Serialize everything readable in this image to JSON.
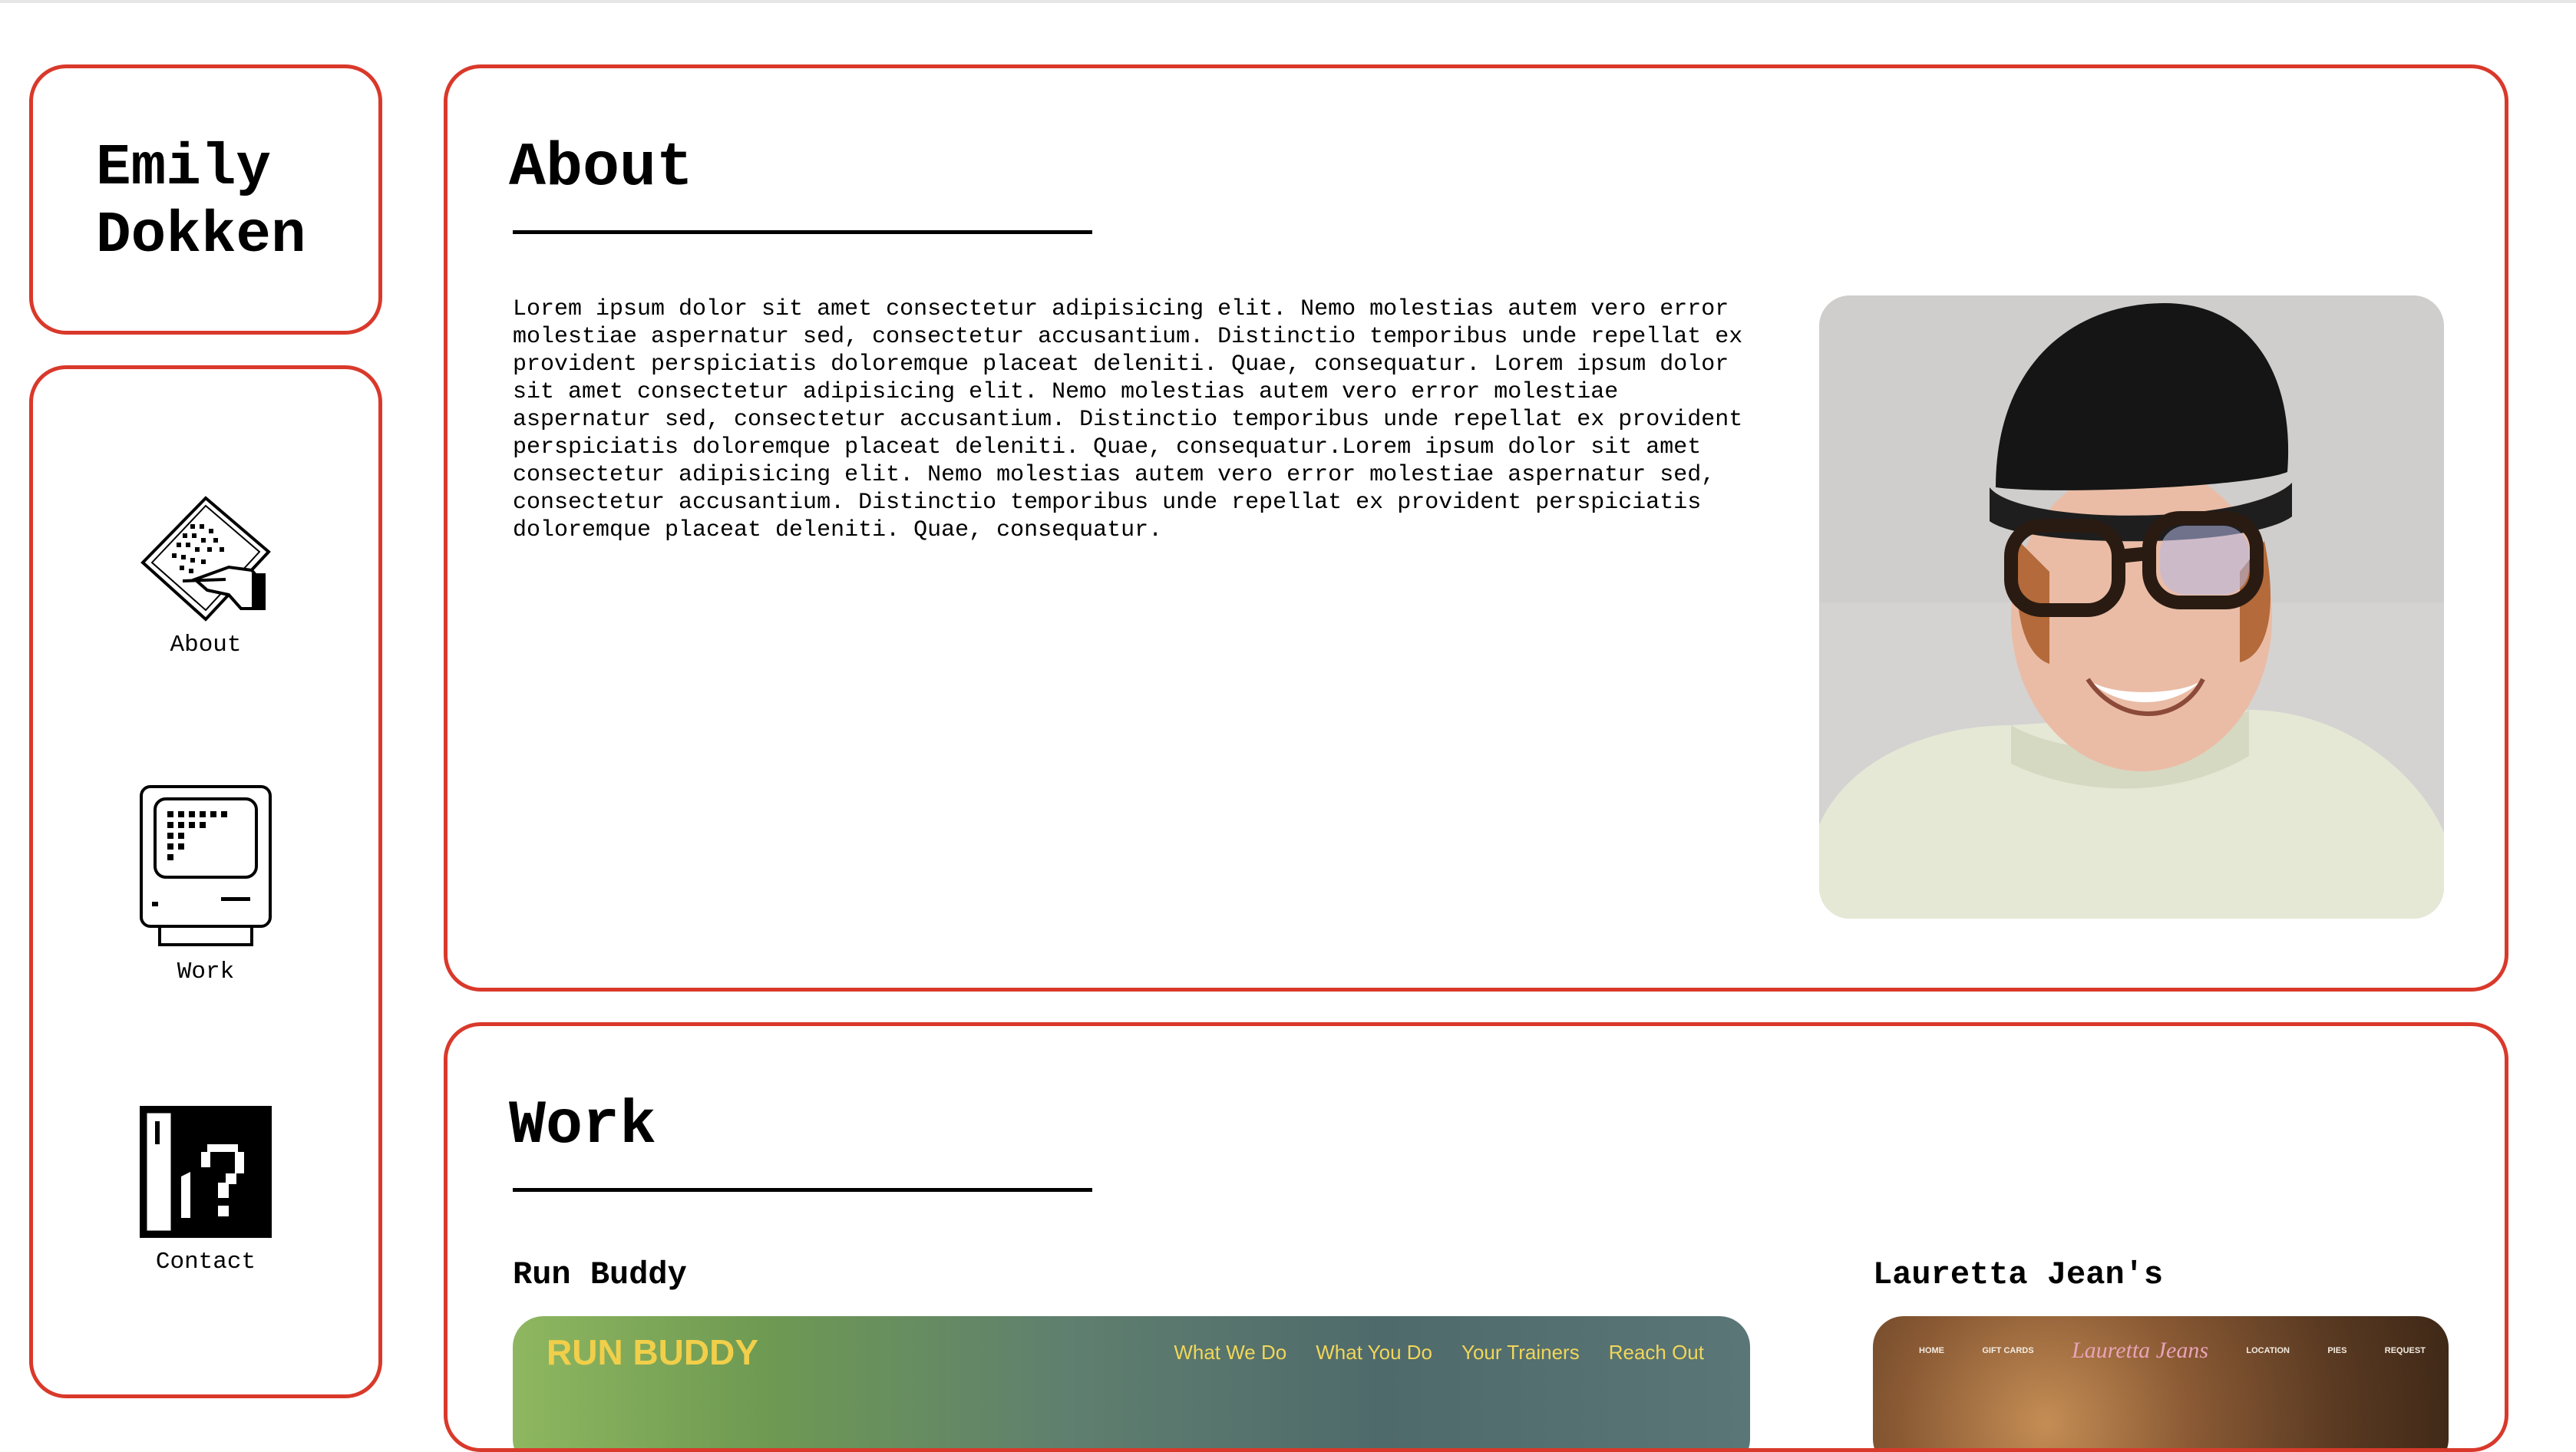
{
  "site": {
    "name": "Emily\nDokken",
    "accent_color": "#d9392b"
  },
  "nav": {
    "items": [
      {
        "label": "About",
        "icon": "pen-writing-icon"
      },
      {
        "label": "Work",
        "icon": "computer-icon"
      },
      {
        "label": "Contact",
        "icon": "help-question-icon"
      }
    ]
  },
  "about": {
    "title": "About",
    "text": "Lorem ipsum dolor sit amet consectetur adipisicing elit. Nemo molestias autem vero error molestiae aspernatur sed, consectetur accusantium. Distinctio temporibus unde repellat ex provident perspiciatis doloremque placeat deleniti. Quae, consequatur. Lorem ipsum dolor sit amet consectetur adipisicing elit. Nemo molestias autem vero error molestiae aspernatur sed, consectetur accusantium. Distinctio temporibus unde repellat ex provident perspiciatis doloremque placeat deleniti. Quae, consequatur.Lorem ipsum dolor sit amet consectetur adipisicing elit. Nemo molestias autem vero error molestiae aspernatur sed, consectetur accusantium. Distinctio temporibus unde repellat ex provident perspiciatis doloremque placeat deleniti. Quae, consequatur.",
    "photo_icon": "portrait-photo"
  },
  "work": {
    "title": "Work",
    "projects": [
      {
        "title": "Run Buddy",
        "brand": "RUN BUDDY",
        "menu": [
          "What We Do",
          "What You Do",
          "Your Trainers",
          "Reach Out"
        ]
      },
      {
        "title": "Lauretta Jean's",
        "logo": "Lauretta Jeans",
        "menu": [
          "HOME",
          "GIFT CARDS",
          "LOCATION",
          "PIES",
          "REQUEST"
        ]
      }
    ]
  }
}
